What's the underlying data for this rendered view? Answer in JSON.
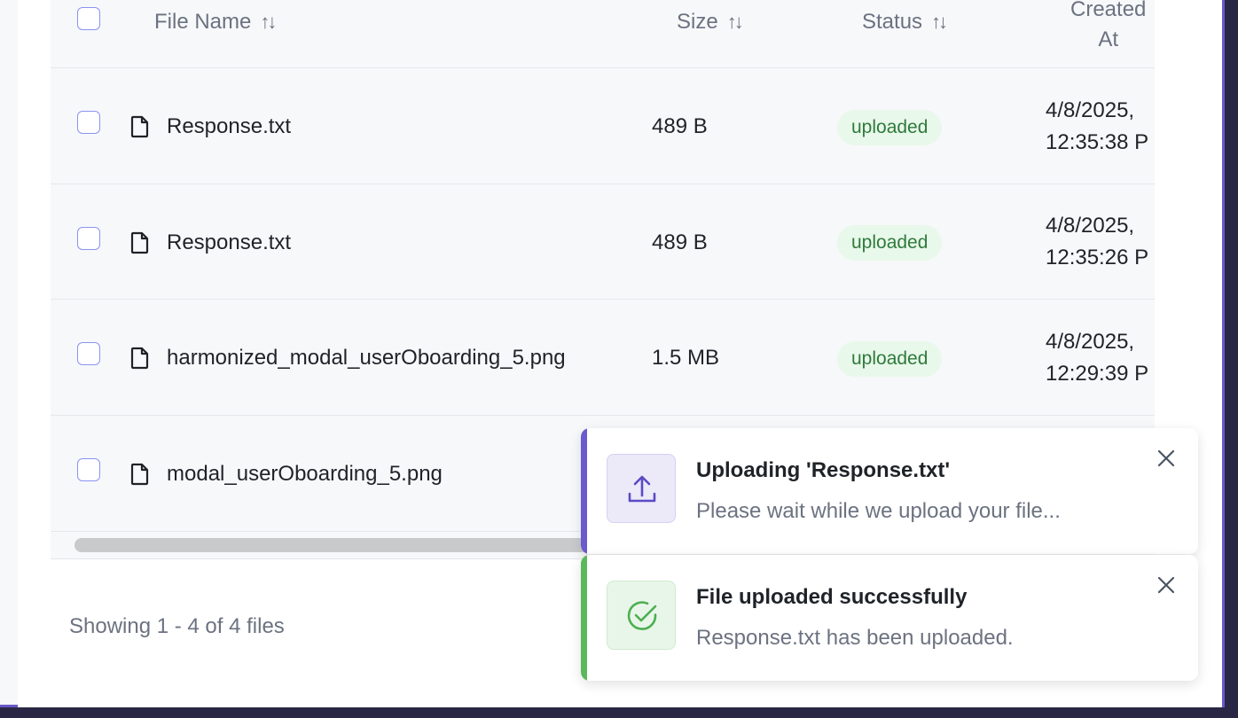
{
  "table": {
    "headers": {
      "file_name": "File Name",
      "size": "Size",
      "status": "Status",
      "created_line1": "Created",
      "created_line2": "At",
      "sort_glyph": "↑↓"
    },
    "rows": [
      {
        "name": "Response.txt",
        "size": "489 B",
        "status": "uploaded",
        "date_line1": "4/8/2025,",
        "date_line2": "12:35:38 P"
      },
      {
        "name": "Response.txt",
        "size": "489 B",
        "status": "uploaded",
        "date_line1": "4/8/2025,",
        "date_line2": "12:35:26 P"
      },
      {
        "name": "harmonized_modal_userOboarding_5.png",
        "size": "1.5 MB",
        "status": "uploaded",
        "date_line1": "4/8/2025,",
        "date_line2": "12:29:39 P"
      },
      {
        "name": "modal_userOboarding_5.png",
        "size": "",
        "status": "",
        "date_line1": "",
        "date_line2": ""
      }
    ],
    "icons": {
      "file": "file-icon",
      "checkbox": "checkbox"
    }
  },
  "footer": {
    "showing": "Showing 1 - 4 of 4 files"
  },
  "toasts": [
    {
      "title": "Uploading 'Response.txt'",
      "message": "Please wait while we upload your file...",
      "icon": "upload-icon",
      "accent": "#6a5acd",
      "icon_bg": "#ece9f9"
    },
    {
      "title": "File uploaded successfully",
      "message": "Response.txt has been uploaded.",
      "icon": "check-circle-icon",
      "accent": "#5cb85c",
      "icon_bg": "#e8f6e9"
    }
  ],
  "colors": {
    "border_accent": "#6658c9",
    "badge_bg": "#e8f8ea",
    "badge_text": "#2f7a3c"
  }
}
